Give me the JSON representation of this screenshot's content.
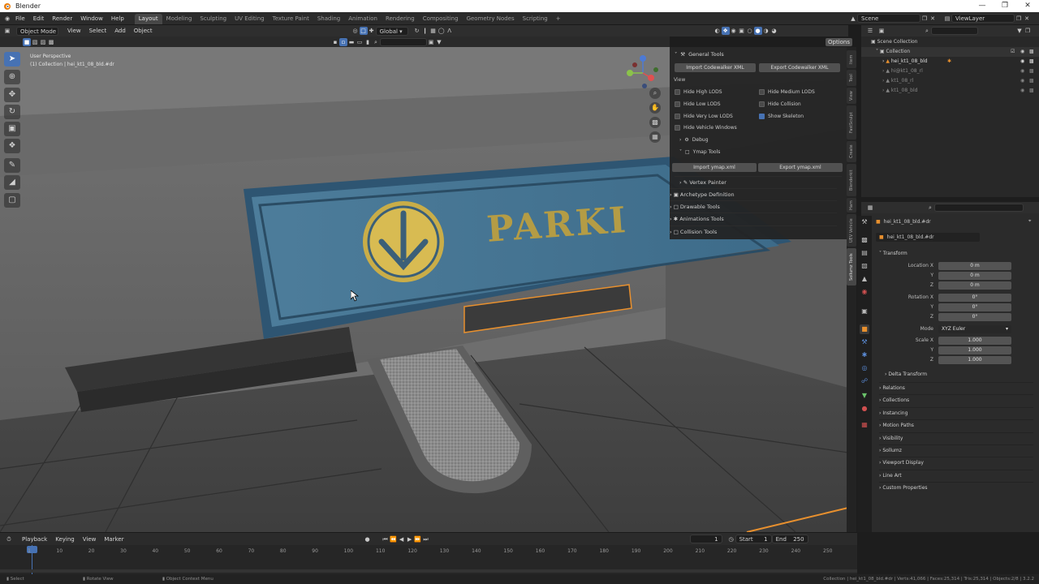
{
  "window": {
    "title": "Blender"
  },
  "menu": [
    "File",
    "Edit",
    "Render",
    "Window",
    "Help"
  ],
  "workspaces": [
    "Layout",
    "Modeling",
    "Sculpting",
    "UV Editing",
    "Texture Paint",
    "Shading",
    "Animation",
    "Rendering",
    "Compositing",
    "Geometry Nodes",
    "Scripting",
    "+"
  ],
  "scene": {
    "name": "Scene",
    "view_layer": "ViewLayer"
  },
  "viewport_header": {
    "mode": "Object Mode",
    "menus": [
      "View",
      "Select",
      "Add",
      "Object"
    ],
    "transform_orientation": "Global",
    "options": "Options"
  },
  "viewport": {
    "view_name": "User Perspective",
    "collection_info": "(1) Collection | hei_kt1_08_bld.#dr"
  },
  "npanel": {
    "general_tools": "General Tools",
    "import_xml": "Import Codewalker XML",
    "export_xml": "Export Codewalker XML",
    "view_label": "View",
    "checks": [
      {
        "label": "Hide High LODS",
        "on": false
      },
      {
        "label": "Hide Medium LODS",
        "on": false
      },
      {
        "label": "Hide Low LODS",
        "on": false
      },
      {
        "label": "Hide Collision",
        "on": false
      },
      {
        "label": "Hide Very Low LODS",
        "on": false
      },
      {
        "label": "Show Skeleton",
        "on": true
      },
      {
        "label": "Hide Vehicle Windows",
        "on": false
      }
    ],
    "debug": "Debug",
    "ymap_tools": "Ymap Tools",
    "import_ymap": "Import ymap.xml",
    "export_ymap": "Export ymap.xml",
    "vertex_painter": "Vertex Painter",
    "archetype": "Archetype Definition",
    "drawable": "Drawable Tools",
    "animations": "Animations Tools",
    "collision": "Collision Tools"
  },
  "npanel_tabs": [
    "Item",
    "Tool",
    "View",
    "FastSculpt",
    "Create",
    "Blenderkit",
    "Ham",
    "UEV Vehicle",
    "Sollumz Tools"
  ],
  "outliner": {
    "root": "Scene Collection",
    "collection": "Collection",
    "items": [
      "hei_kt1_08_bld",
      "hi@kt1_08_rl",
      "kt1_08_rl",
      "kt1_08_bld"
    ]
  },
  "properties": {
    "object_name": "hei_kt1_08_bld.#dr",
    "data_name": "hei_kt1_08_bld.#dr",
    "transform": "Transform",
    "location_x_label": "Location X",
    "location": [
      "0 m",
      "0 m",
      "0 m"
    ],
    "rotation_x_label": "Rotation X",
    "rotation": [
      "0°",
      "0°",
      "0°"
    ],
    "mode_label": "Mode",
    "mode": "XYZ Euler",
    "scale_x_label": "Scale X",
    "scale": [
      "1.000",
      "1.000",
      "1.000"
    ],
    "axis_y": "Y",
    "axis_z": "Z",
    "delta": "Delta Transform",
    "sections": [
      "Relations",
      "Collections",
      "Instancing",
      "Motion Paths",
      "Visibility",
      "Sollumz",
      "Viewport Display",
      "Line Art",
      "Custom Properties"
    ]
  },
  "timeline": {
    "menus": [
      "Playback",
      "Keying",
      "View",
      "Marker"
    ],
    "current_frame": "1",
    "start_label": "Start",
    "start": "1",
    "end_label": "End",
    "end": "250",
    "ticks": [
      "1",
      "10",
      "20",
      "30",
      "40",
      "50",
      "60",
      "70",
      "80",
      "90",
      "100",
      "110",
      "120",
      "130",
      "140",
      "150",
      "160",
      "170",
      "180",
      "190",
      "200",
      "210",
      "220",
      "230",
      "240",
      "250"
    ]
  },
  "status": {
    "left": [
      "Select",
      "Rotate View",
      "Object Context Menu"
    ],
    "right": "Collection | hei_kt1_08_bld.#dr | Verts:41,066 | Faces:25,314 | Tris:25,314 | Objects:2/8 | 3.2.2"
  },
  "sign": {
    "text": "PARKI"
  }
}
